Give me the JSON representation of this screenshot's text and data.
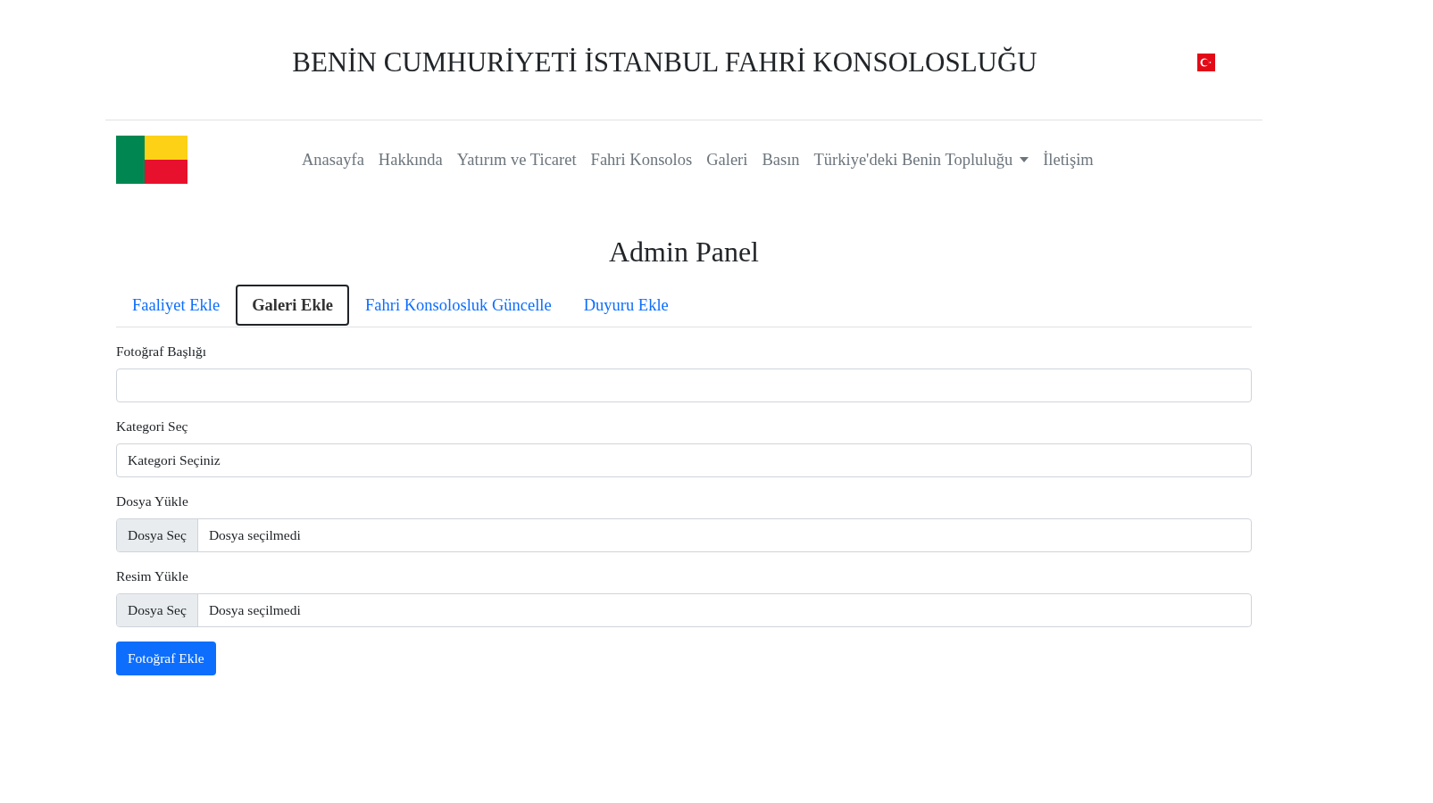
{
  "header": {
    "title": "BENİN CUMHURİYETİ İSTANBUL FAHRİ KONSOLOSLUĞU"
  },
  "nav": {
    "items": [
      {
        "label": "Anasayfa",
        "kind": "link"
      },
      {
        "label": "Hakkında",
        "kind": "link"
      },
      {
        "label": "Yatırım ve Ticaret",
        "kind": "link"
      },
      {
        "label": "Fahri Konsolos",
        "kind": "link"
      },
      {
        "label": "Galeri",
        "kind": "link"
      },
      {
        "label": "Basın",
        "kind": "link"
      },
      {
        "label": "Türkiye'deki Benin Topluluğu",
        "kind": "dropdown"
      },
      {
        "label": "İletişim",
        "kind": "link"
      }
    ]
  },
  "page_title": "Admin Panel",
  "tabs": [
    {
      "label": "Faaliyet Ekle",
      "selected": false
    },
    {
      "label": "Galeri Ekle",
      "selected": true
    },
    {
      "label": "Fahri Konsolosluk Güncelle",
      "selected": false
    },
    {
      "label": "Duyuru Ekle",
      "selected": false
    }
  ],
  "form": {
    "fields": [
      {
        "label": "Fotoğraf Başlığı",
        "kind": "text"
      },
      {
        "label": "Kategori Seç",
        "kind": "select",
        "value": "Kategori Seçiniz"
      },
      {
        "label": "Dosya Yükle",
        "kind": "file",
        "button": "Dosya Seç",
        "status": "Dosya seçilmedi"
      },
      {
        "label": "Resim Yükle",
        "kind": "file",
        "button": "Dosya Seç",
        "status": "Dosya seçilmedi"
      }
    ],
    "submit": "Fotoğraf Ekle"
  }
}
